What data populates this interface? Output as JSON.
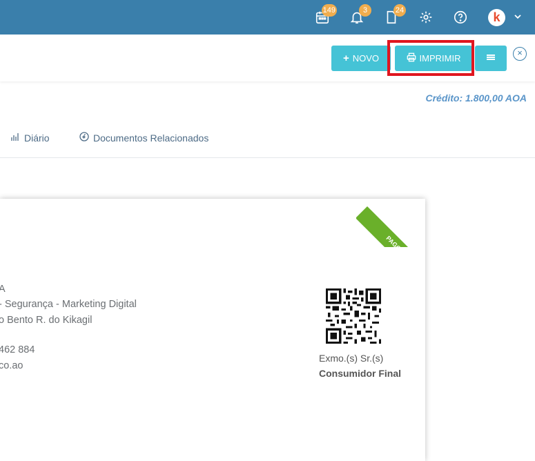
{
  "topbar": {
    "badges": {
      "calendar": "149",
      "bell": "3",
      "document": "24"
    },
    "icons": [
      "calendar-icon",
      "bell-icon",
      "document-icon",
      "gear-icon",
      "help-icon",
      "avatar",
      "chevron-down-icon"
    ]
  },
  "actions": {
    "novo": "NOVO",
    "imprimir": "IMPRIMIR",
    "menu_icon": "menu-icon"
  },
  "credit": "Crédito: 1.800,00 AOA",
  "tabs": [
    {
      "label": "Diário",
      "icon": "chart-icon"
    },
    {
      "label": "Documentos Relacionados",
      "icon": "link-icon"
    }
  ],
  "document": {
    "ribbon": "PAGO",
    "issuer_lines": [
      "A",
      "- Segurança - Marketing Digital",
      "o Bento R. do Kikagil",
      "462 884",
      "co.ao"
    ],
    "client_label": "Exmo.(s) Sr.(s)",
    "client_name": "Consumidor Final"
  },
  "colors": {
    "topbar": "#3a7fab",
    "button": "#45c3d6",
    "badge": "#f0ad4e",
    "ribbon": "#6ab02a",
    "highlight": "#e0161f"
  }
}
